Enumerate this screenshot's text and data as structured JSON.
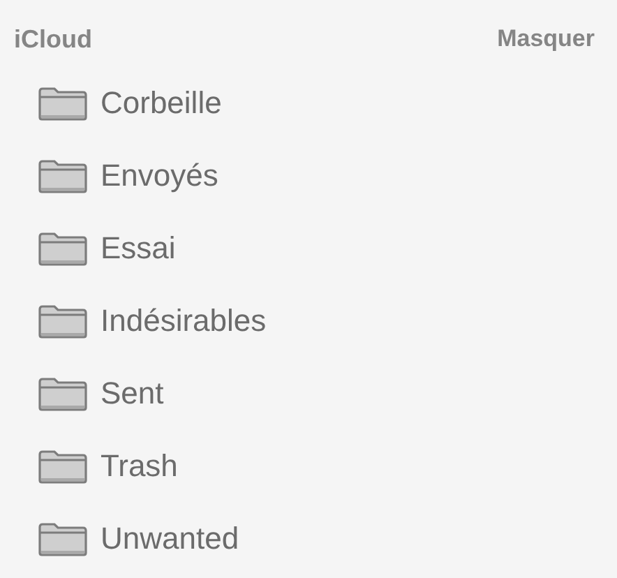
{
  "section": {
    "title": "iCloud",
    "action": "Masquer"
  },
  "folders": [
    {
      "label": "Corbeille"
    },
    {
      "label": "Envoyés"
    },
    {
      "label": "Essai"
    },
    {
      "label": "Indésirables"
    },
    {
      "label": "Sent"
    },
    {
      "label": "Trash"
    },
    {
      "label": "Unwanted"
    }
  ]
}
